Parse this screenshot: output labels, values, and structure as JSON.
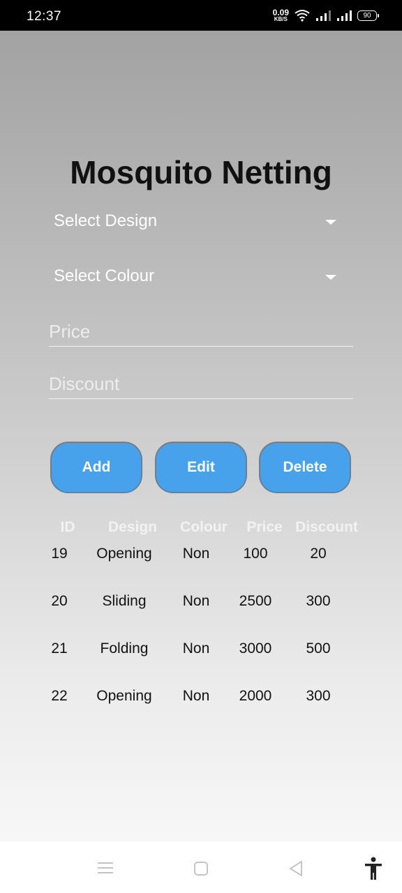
{
  "status_bar": {
    "time": "12:37",
    "net_speed_value": "0.09",
    "net_speed_unit": "KB/S",
    "battery": "90",
    "icons": [
      "wifi-icon",
      "signal-icon",
      "signal-icon",
      "battery-icon"
    ]
  },
  "title": "Mosquito Netting",
  "form": {
    "design_select": "Select Design",
    "colour_select": "Select Colour",
    "price_placeholder": "Price",
    "discount_placeholder": "Discount"
  },
  "buttons": {
    "add": "Add",
    "edit": "Edit",
    "delete": "Delete"
  },
  "table": {
    "headers": [
      "ID",
      "Design",
      "Colour",
      "Price",
      "Discount"
    ],
    "rows": [
      [
        "19",
        "Opening",
        "Non",
        "100",
        "20"
      ],
      [
        "20",
        "Sliding",
        "Non",
        "2500",
        "300"
      ],
      [
        "21",
        "Folding",
        "Non",
        "3000",
        "500"
      ],
      [
        "22",
        "Opening",
        "Non",
        "2000",
        "300"
      ]
    ]
  },
  "nav_bar": {
    "icons": [
      "menu-icon",
      "home-icon",
      "back-icon",
      "accessibility-icon"
    ]
  },
  "colors": {
    "button": "#47a2eb",
    "header_text": "#f2f2f2",
    "title": "#111111"
  }
}
